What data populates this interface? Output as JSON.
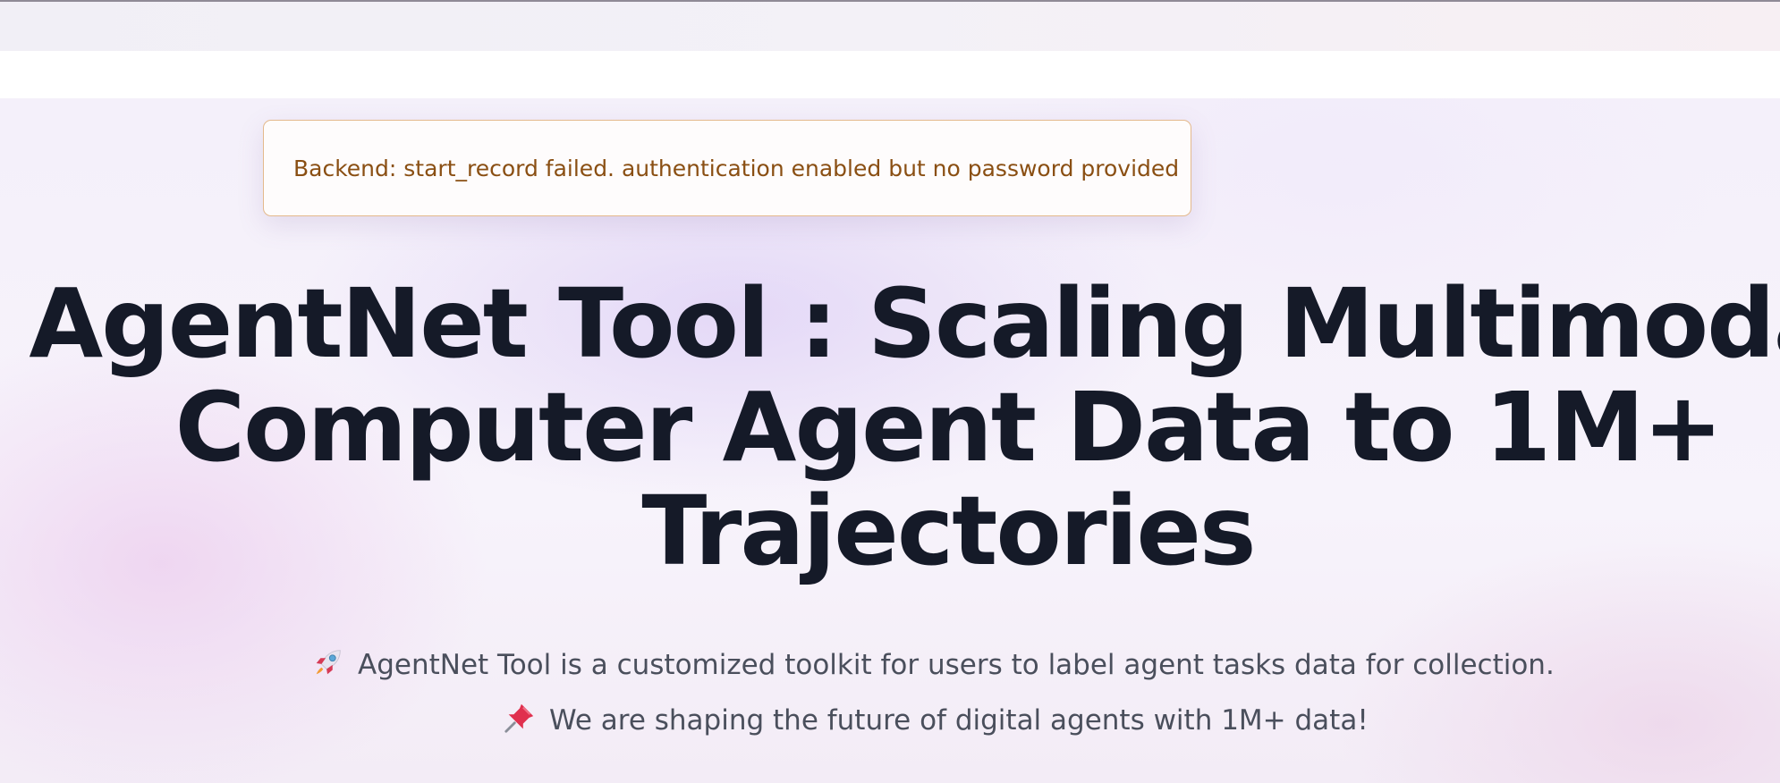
{
  "alert": {
    "message": "Backend: start_record failed. authentication enabled but no password provided"
  },
  "hero": {
    "title_lines": [
      "AgentNet Tool : Scaling Multimodal",
      "Computer Agent Data to 1M+",
      "Trajectories"
    ],
    "subtitle_1": "AgentNet Tool is a customized toolkit for users to label agent tasks data for collection.",
    "subtitle_2": "We are shaping the future of digital agents with 1M+ data!",
    "subtitle_1_icon": "rocket-icon",
    "subtitle_2_icon": "pushpin-icon"
  },
  "colors": {
    "title": "#151a28",
    "alert_border": "#e4b98c",
    "alert_text": "#8a4f13",
    "subtitle": "#4a4f5c"
  }
}
